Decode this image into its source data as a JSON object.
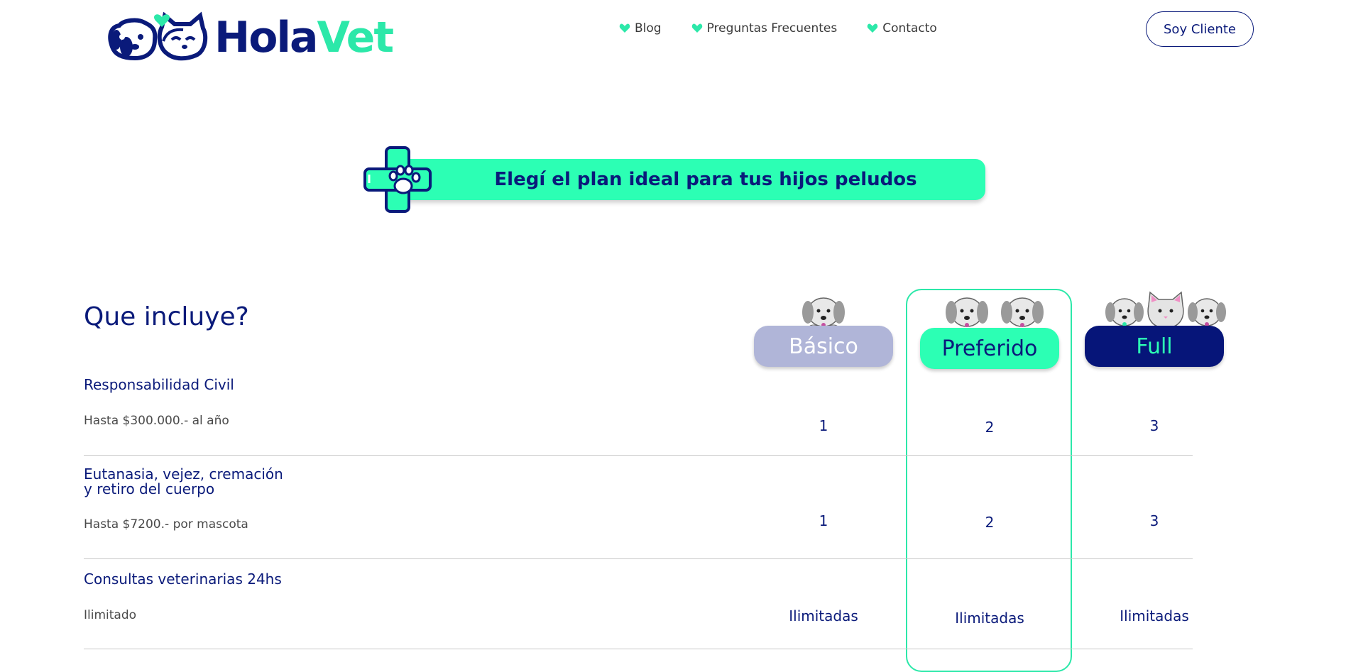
{
  "brand": {
    "hola": "Hola",
    "vet": "Vet"
  },
  "nav": [
    {
      "label": "Blog"
    },
    {
      "label": "Preguntas Frecuentes"
    },
    {
      "label": "Contacto"
    }
  ],
  "client_button": "Soy Cliente",
  "banner_text": "Elegí el plan ideal para tus hijos peludos",
  "section_title": "Que incluye?",
  "plans": [
    {
      "name": "Básico"
    },
    {
      "name": "Preferido"
    },
    {
      "name": "Full"
    }
  ],
  "features": [
    {
      "title": "Responsabilidad Civil",
      "subtitle": "Hasta $300.000.- al año",
      "values": [
        "1",
        "2",
        "3"
      ]
    },
    {
      "title_line1": "Eutanasia, vejez, cremación",
      "title_line2": "y retiro del cuerpo",
      "subtitle": "Hasta $7200.- por mascota",
      "values": [
        "1",
        "2",
        "3"
      ]
    },
    {
      "title": "Consultas veterinarias 24hs",
      "subtitle": "Ilimitado",
      "values": [
        "Ilimitadas",
        "Ilimitadas",
        "Ilimitadas"
      ]
    }
  ],
  "colors": {
    "navy": "#0a1a7a",
    "mint": "#2cffb4",
    "lavender": "#b0b5d8"
  }
}
